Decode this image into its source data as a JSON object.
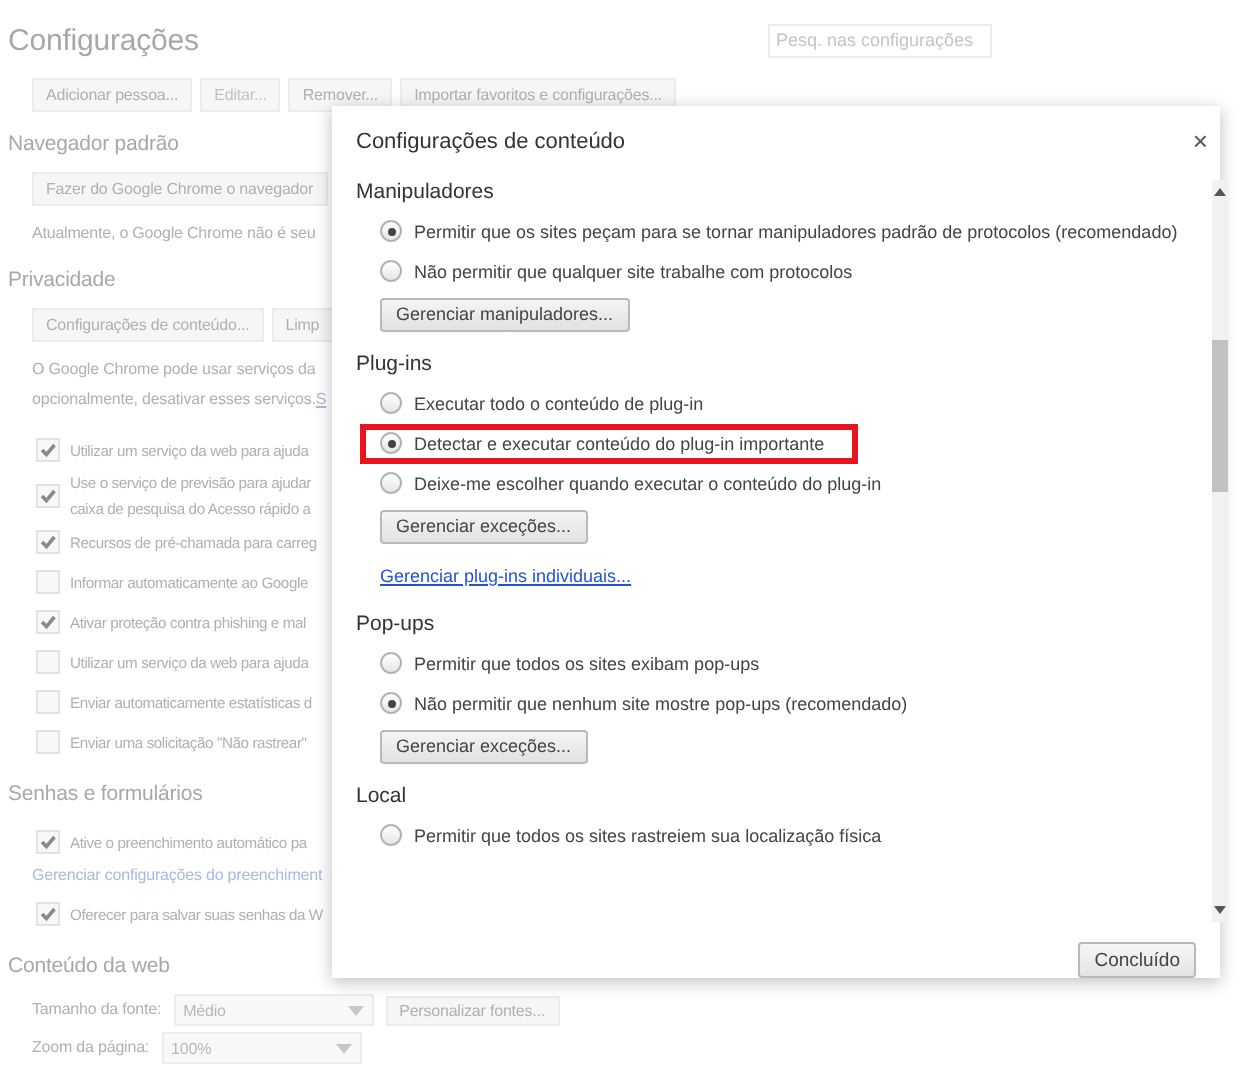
{
  "page": {
    "title": "Configurações",
    "search": {
      "placeholder": "Pesq. nas configurações"
    },
    "sections": [
      {
        "items": [
          {
            "kind": "buttons",
            "buttons": [
              {
                "label": "Adicionar pessoa...",
                "disabled": false
              },
              {
                "label": "Editar...",
                "disabled": true
              },
              {
                "label": "Remover...",
                "disabled": false
              },
              {
                "label": "Importar favoritos e configurações...",
                "disabled": false
              }
            ]
          }
        ]
      },
      {
        "heading": "Navegador padrão",
        "items": [
          {
            "kind": "buttons",
            "buttons": [
              {
                "label": "Fazer do Google Chrome o navegador",
                "disabled": false
              }
            ]
          },
          {
            "kind": "text",
            "text": "Atualmente, o Google Chrome não é seu"
          }
        ]
      },
      {
        "heading": "Privacidade",
        "items": [
          {
            "kind": "buttons",
            "buttons": [
              {
                "label": "Configurações de conteúdo...",
                "disabled": false
              },
              {
                "label": "Limp",
                "disabled": false
              }
            ]
          },
          {
            "kind": "text",
            "lines": [
              "O Google Chrome pode usar serviços da",
              "opcionalmente, desativar esses serviços."
            ],
            "link": "S"
          },
          {
            "kind": "checkbox",
            "checked": true,
            "lines": [
              "Utilizar um serviço da web para ajuda"
            ]
          },
          {
            "kind": "checkbox",
            "checked": true,
            "lines": [
              "Use o serviço de previsão para ajudar",
              "caixa de pesquisa do Acesso rápido a"
            ]
          },
          {
            "kind": "checkbox",
            "checked": true,
            "lines": [
              "Recursos de pré-chamada para carreg"
            ]
          },
          {
            "kind": "checkbox",
            "checked": false,
            "lines": [
              "Informar automaticamente ao Google"
            ]
          },
          {
            "kind": "checkbox",
            "checked": true,
            "lines": [
              "Ativar proteção contra phishing e mal"
            ]
          },
          {
            "kind": "checkbox",
            "checked": false,
            "lines": [
              "Utilizar um serviço da web para ajuda"
            ]
          },
          {
            "kind": "checkbox",
            "checked": false,
            "lines": [
              "Enviar automaticamente estatísticas d"
            ]
          },
          {
            "kind": "checkbox",
            "checked": false,
            "lines": [
              "Enviar uma solicitação \"Não rastrear\""
            ]
          }
        ]
      },
      {
        "heading": "Senhas e formulários",
        "items": [
          {
            "kind": "checkbox",
            "checked": true,
            "lines": [
              "Ative o preenchimento automático pa"
            ]
          },
          {
            "kind": "link",
            "text": "Gerenciar configurações do preenchiment"
          },
          {
            "kind": "checkbox",
            "checked": true,
            "lines": [
              "Oferecer para salvar suas senhas da W"
            ]
          }
        ]
      },
      {
        "heading": "Conteúdo da web",
        "items": [
          {
            "kind": "select",
            "label": "Tamanho da fonte:",
            "value": "Médio",
            "button": "Personalizar fontes..."
          },
          {
            "kind": "select",
            "label": "Zoom da página:",
            "value": "100%"
          }
        ]
      }
    ]
  },
  "dialog": {
    "title": "Configurações de conteúdo",
    "close": "×",
    "sections": [
      {
        "heading": "Manipuladores",
        "options": [
          {
            "label": "Permitir que os sites peçam para se tornar manipuladores padrão de protocolos (recomendado)",
            "selected": true,
            "highlighted": false
          },
          {
            "label": "Não permitir que qualquer site trabalhe com protocolos",
            "selected": false,
            "highlighted": false
          }
        ],
        "button": "Gerenciar manipuladores..."
      },
      {
        "heading": "Plug-ins",
        "options": [
          {
            "label": "Executar todo o conteúdo de plug-in",
            "selected": false,
            "highlighted": false
          },
          {
            "label": "Detectar e executar conteúdo do plug-in importante",
            "selected": true,
            "highlighted": true
          },
          {
            "label": "Deixe-me escolher quando executar o conteúdo do plug-in",
            "selected": false,
            "highlighted": false
          }
        ],
        "button": "Gerenciar exceções...",
        "link": "Gerenciar plug-ins individuais..."
      },
      {
        "heading": "Pop-ups",
        "options": [
          {
            "label": "Permitir que todos os sites exibam pop-ups",
            "selected": false,
            "highlighted": false
          },
          {
            "label": "Não permitir que nenhum site mostre pop-ups (recomendado)",
            "selected": true,
            "highlighted": false
          }
        ],
        "button": "Gerenciar exceções..."
      },
      {
        "heading": "Local",
        "options": [
          {
            "label": "Permitir que todos os sites rastreiem sua localização física",
            "selected": false,
            "highlighted": false
          }
        ]
      }
    ],
    "done": "Concluído"
  }
}
